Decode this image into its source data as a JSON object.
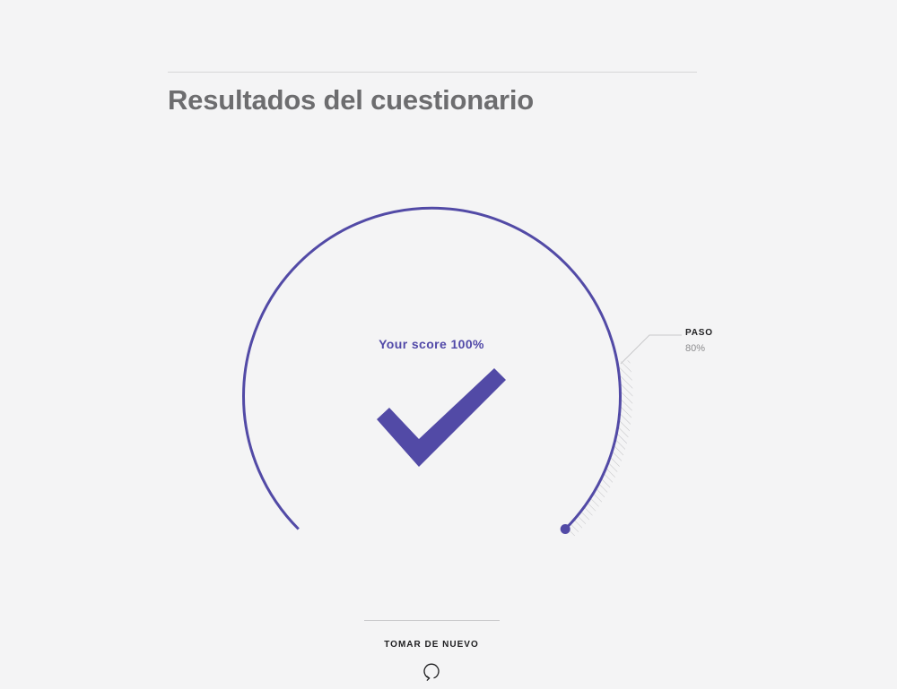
{
  "header": {
    "title": "Resultados del cuestionario"
  },
  "result": {
    "score_text": "Your score 100%",
    "score_percent": 100,
    "status_icon": "checkmark-icon",
    "accent_color": "#524aa6"
  },
  "pass_marker": {
    "label": "PASO",
    "value_text": "80%",
    "threshold_percent": 80
  },
  "actions": {
    "retake_label": "TOMAR DE NUEVO",
    "retake_icon": "refresh-icon"
  }
}
